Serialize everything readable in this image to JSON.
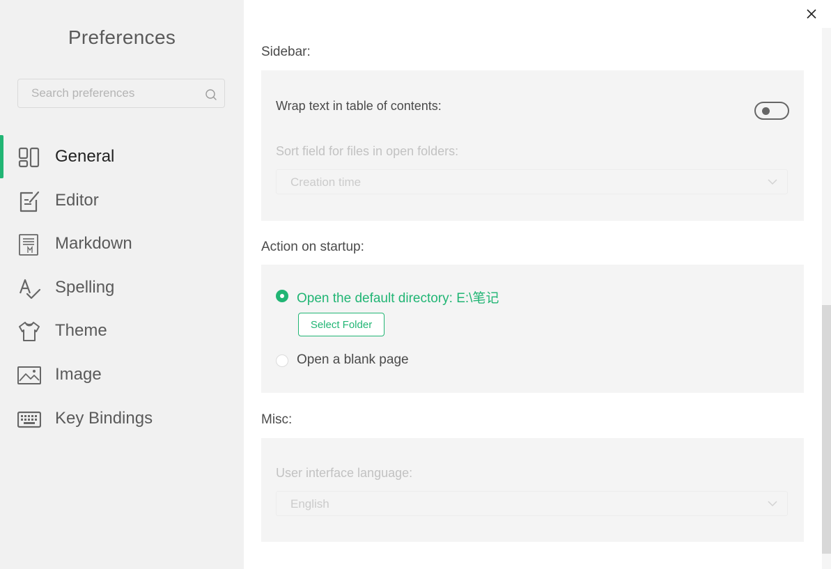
{
  "sidebar": {
    "title": "Preferences",
    "search": {
      "placeholder": "Search preferences",
      "value": ""
    },
    "items": [
      {
        "label": "General",
        "icon": "general-icon",
        "active": true
      },
      {
        "label": "Editor",
        "icon": "editor-icon",
        "active": false
      },
      {
        "label": "Markdown",
        "icon": "markdown-icon",
        "active": false
      },
      {
        "label": "Spelling",
        "icon": "spelling-icon",
        "active": false
      },
      {
        "label": "Theme",
        "icon": "theme-icon",
        "active": false
      },
      {
        "label": "Image",
        "icon": "image-icon",
        "active": false
      },
      {
        "label": "Key Bindings",
        "icon": "keyboard-icon",
        "active": false
      }
    ]
  },
  "main": {
    "sidebar_section": {
      "title": "Sidebar:",
      "wrap_toc_label": "Wrap text in table of contents:",
      "wrap_toc_enabled": false,
      "sort_label": "Sort field for files in open folders:",
      "sort_value": "Creation time"
    },
    "startup_section": {
      "title": "Action on startup:",
      "option_default_dir": "Open the default directory: E:\\笔记",
      "select_folder_label": "Select Folder",
      "option_blank_page": "Open a blank page",
      "selected": "default_dir"
    },
    "misc_section": {
      "title": "Misc:",
      "language_label": "User interface language:",
      "language_value": "English"
    }
  },
  "colors": {
    "accent": "#21b574",
    "sidebar_bg": "#f1f1f1",
    "panel_bg": "#f4f4f4"
  }
}
